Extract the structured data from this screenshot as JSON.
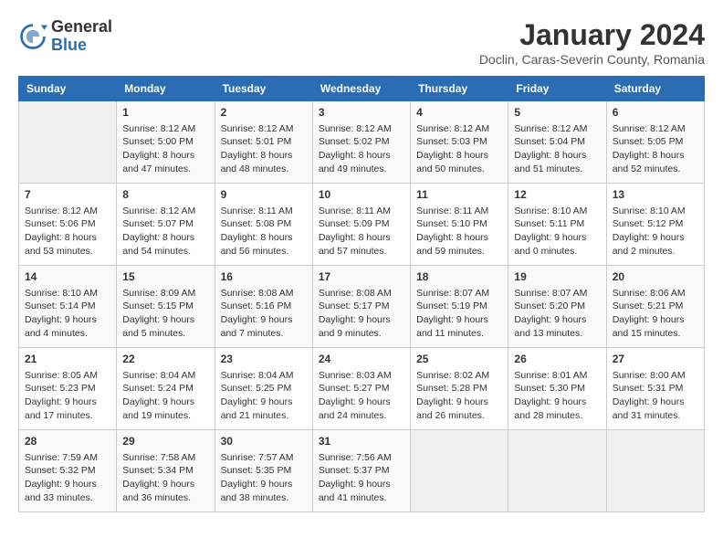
{
  "header": {
    "logo_general": "General",
    "logo_blue": "Blue",
    "month_title": "January 2024",
    "subtitle": "Doclin, Caras-Severin County, Romania"
  },
  "columns": [
    "Sunday",
    "Monday",
    "Tuesday",
    "Wednesday",
    "Thursday",
    "Friday",
    "Saturday"
  ],
  "weeks": [
    [
      {
        "day": "",
        "info": ""
      },
      {
        "day": "1",
        "info": "Sunrise: 8:12 AM\nSunset: 5:00 PM\nDaylight: 8 hours and 47 minutes."
      },
      {
        "day": "2",
        "info": "Sunrise: 8:12 AM\nSunset: 5:01 PM\nDaylight: 8 hours and 48 minutes."
      },
      {
        "day": "3",
        "info": "Sunrise: 8:12 AM\nSunset: 5:02 PM\nDaylight: 8 hours and 49 minutes."
      },
      {
        "day": "4",
        "info": "Sunrise: 8:12 AM\nSunset: 5:03 PM\nDaylight: 8 hours and 50 minutes."
      },
      {
        "day": "5",
        "info": "Sunrise: 8:12 AM\nSunset: 5:04 PM\nDaylight: 8 hours and 51 minutes."
      },
      {
        "day": "6",
        "info": "Sunrise: 8:12 AM\nSunset: 5:05 PM\nDaylight: 8 hours and 52 minutes."
      }
    ],
    [
      {
        "day": "7",
        "info": "Sunrise: 8:12 AM\nSunset: 5:06 PM\nDaylight: 8 hours and 53 minutes."
      },
      {
        "day": "8",
        "info": "Sunrise: 8:12 AM\nSunset: 5:07 PM\nDaylight: 8 hours and 54 minutes."
      },
      {
        "day": "9",
        "info": "Sunrise: 8:11 AM\nSunset: 5:08 PM\nDaylight: 8 hours and 56 minutes."
      },
      {
        "day": "10",
        "info": "Sunrise: 8:11 AM\nSunset: 5:09 PM\nDaylight: 8 hours and 57 minutes."
      },
      {
        "day": "11",
        "info": "Sunrise: 8:11 AM\nSunset: 5:10 PM\nDaylight: 8 hours and 59 minutes."
      },
      {
        "day": "12",
        "info": "Sunrise: 8:10 AM\nSunset: 5:11 PM\nDaylight: 9 hours and 0 minutes."
      },
      {
        "day": "13",
        "info": "Sunrise: 8:10 AM\nSunset: 5:12 PM\nDaylight: 9 hours and 2 minutes."
      }
    ],
    [
      {
        "day": "14",
        "info": "Sunrise: 8:10 AM\nSunset: 5:14 PM\nDaylight: 9 hours and 4 minutes."
      },
      {
        "day": "15",
        "info": "Sunrise: 8:09 AM\nSunset: 5:15 PM\nDaylight: 9 hours and 5 minutes."
      },
      {
        "day": "16",
        "info": "Sunrise: 8:08 AM\nSunset: 5:16 PM\nDaylight: 9 hours and 7 minutes."
      },
      {
        "day": "17",
        "info": "Sunrise: 8:08 AM\nSunset: 5:17 PM\nDaylight: 9 hours and 9 minutes."
      },
      {
        "day": "18",
        "info": "Sunrise: 8:07 AM\nSunset: 5:19 PM\nDaylight: 9 hours and 11 minutes."
      },
      {
        "day": "19",
        "info": "Sunrise: 8:07 AM\nSunset: 5:20 PM\nDaylight: 9 hours and 13 minutes."
      },
      {
        "day": "20",
        "info": "Sunrise: 8:06 AM\nSunset: 5:21 PM\nDaylight: 9 hours and 15 minutes."
      }
    ],
    [
      {
        "day": "21",
        "info": "Sunrise: 8:05 AM\nSunset: 5:23 PM\nDaylight: 9 hours and 17 minutes."
      },
      {
        "day": "22",
        "info": "Sunrise: 8:04 AM\nSunset: 5:24 PM\nDaylight: 9 hours and 19 minutes."
      },
      {
        "day": "23",
        "info": "Sunrise: 8:04 AM\nSunset: 5:25 PM\nDaylight: 9 hours and 21 minutes."
      },
      {
        "day": "24",
        "info": "Sunrise: 8:03 AM\nSunset: 5:27 PM\nDaylight: 9 hours and 24 minutes."
      },
      {
        "day": "25",
        "info": "Sunrise: 8:02 AM\nSunset: 5:28 PM\nDaylight: 9 hours and 26 minutes."
      },
      {
        "day": "26",
        "info": "Sunrise: 8:01 AM\nSunset: 5:30 PM\nDaylight: 9 hours and 28 minutes."
      },
      {
        "day": "27",
        "info": "Sunrise: 8:00 AM\nSunset: 5:31 PM\nDaylight: 9 hours and 31 minutes."
      }
    ],
    [
      {
        "day": "28",
        "info": "Sunrise: 7:59 AM\nSunset: 5:32 PM\nDaylight: 9 hours and 33 minutes."
      },
      {
        "day": "29",
        "info": "Sunrise: 7:58 AM\nSunset: 5:34 PM\nDaylight: 9 hours and 36 minutes."
      },
      {
        "day": "30",
        "info": "Sunrise: 7:57 AM\nSunset: 5:35 PM\nDaylight: 9 hours and 38 minutes."
      },
      {
        "day": "31",
        "info": "Sunrise: 7:56 AM\nSunset: 5:37 PM\nDaylight: 9 hours and 41 minutes."
      },
      {
        "day": "",
        "info": ""
      },
      {
        "day": "",
        "info": ""
      },
      {
        "day": "",
        "info": ""
      }
    ]
  ]
}
